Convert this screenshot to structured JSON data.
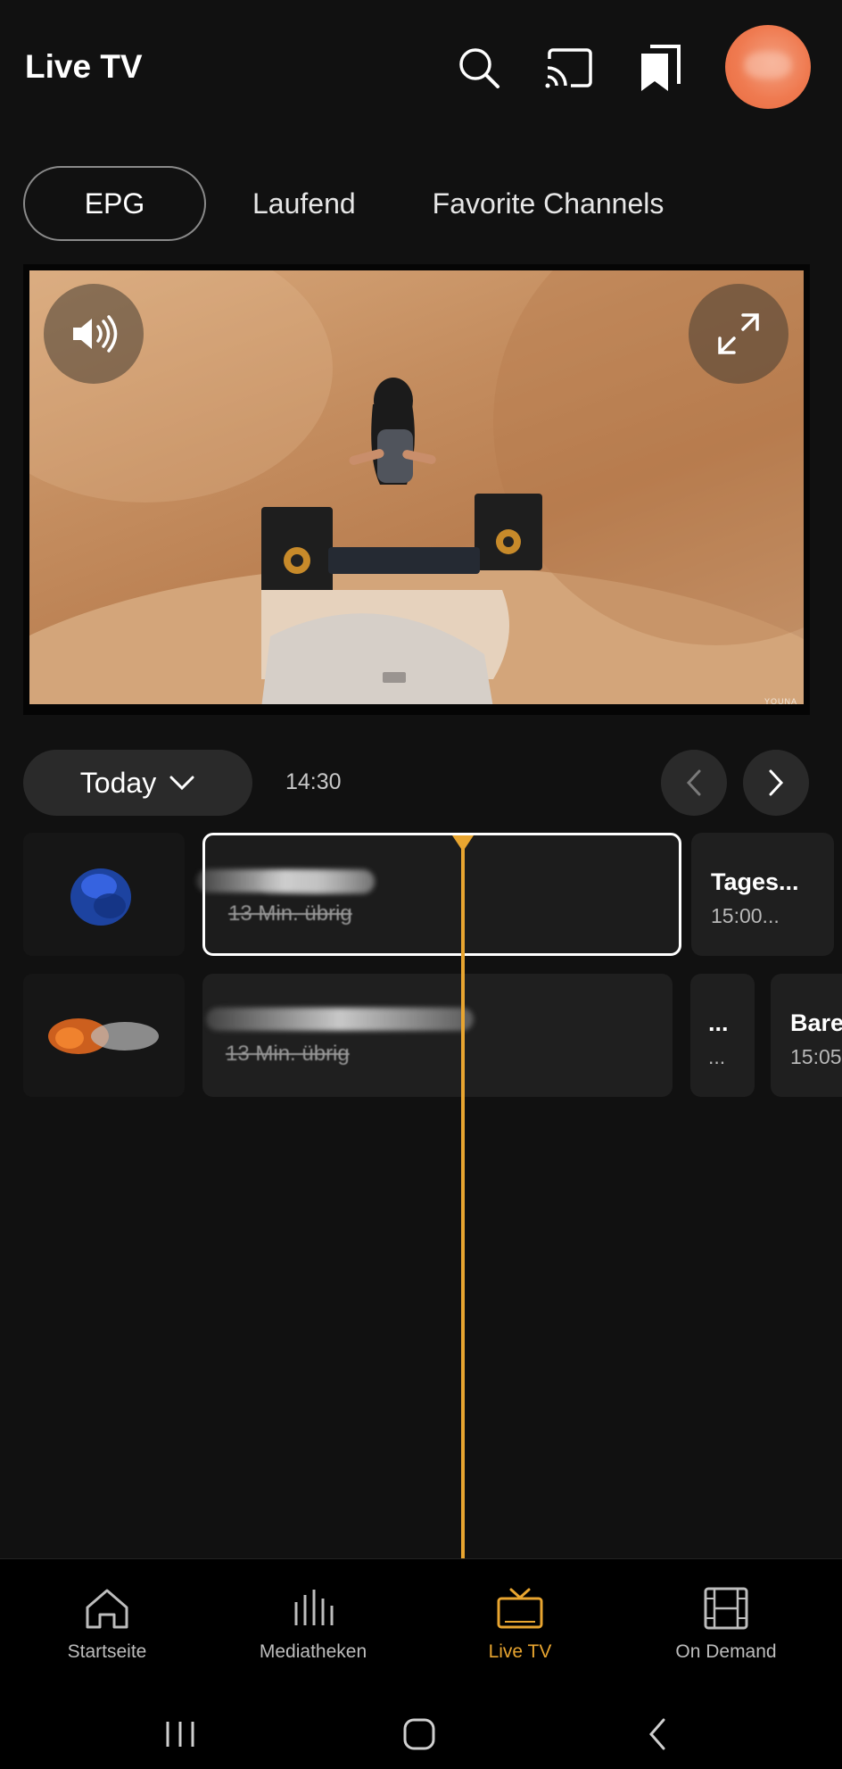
{
  "header": {
    "title": "Live TV",
    "icons": [
      "search-icon",
      "cast-icon",
      "bookmarks-icon",
      "avatar"
    ]
  },
  "tabs": [
    {
      "label": "EPG",
      "active": true
    },
    {
      "label": "Laufend",
      "active": false
    },
    {
      "label": "Favorite Channels",
      "active": false
    }
  ],
  "player": {
    "watermark": "YOUNA",
    "icons": [
      "volume-icon",
      "fullscreen-icon"
    ]
  },
  "schedule": {
    "day": "Today",
    "time": "14:30"
  },
  "rows": [
    {
      "current": {
        "title": "",
        "subtitle": "13 Min. übrig"
      },
      "next": [
        {
          "title": "Tages...",
          "time": "15:00..."
        }
      ]
    },
    {
      "current": {
        "title": "",
        "subtitle": "13 Min. übrig"
      },
      "next": [
        {
          "title": "...",
          "time": "..."
        },
        {
          "title": "Bare",
          "time": "15:05"
        }
      ]
    }
  ],
  "colors": {
    "accent": "#e8a530",
    "background": "#111111",
    "card": "#1f1f1f"
  },
  "bottom_nav": [
    {
      "label": "Startseite",
      "icon": "home-icon",
      "active": false
    },
    {
      "label": "Mediatheken",
      "icon": "library-icon",
      "active": false
    },
    {
      "label": "Live TV",
      "icon": "tv-icon",
      "active": true
    },
    {
      "label": "On Demand",
      "icon": "film-icon",
      "active": false
    }
  ]
}
